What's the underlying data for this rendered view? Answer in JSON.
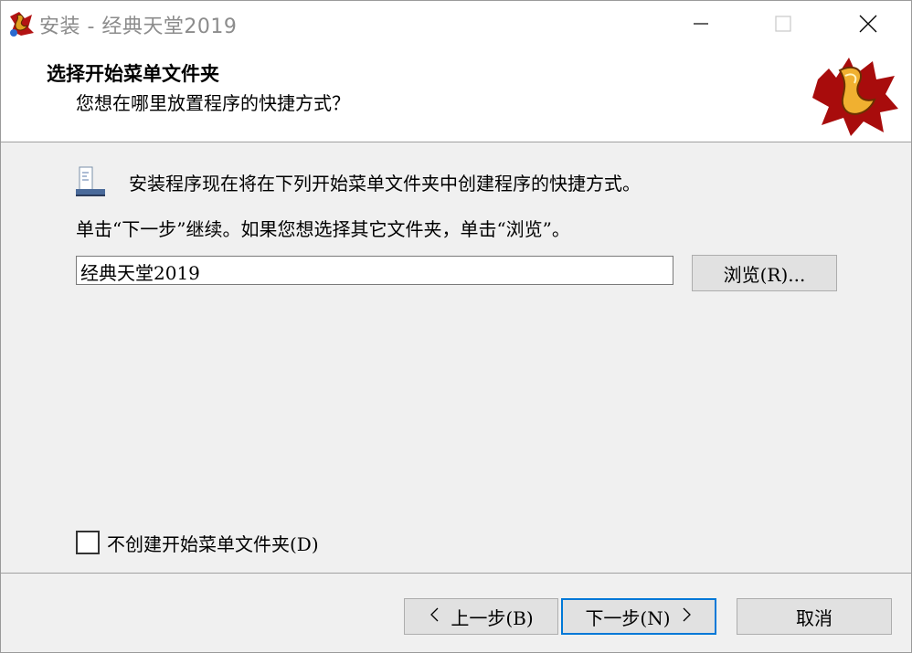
{
  "window": {
    "title": "安装 - 经典天堂2019",
    "icons": {
      "app": "game-logo-icon",
      "minimize": "minimize-icon",
      "maximize": "maximize-icon",
      "close": "close-icon"
    }
  },
  "header": {
    "title": "选择开始菜单文件夹",
    "subtitle": "您想在哪里放置程序的快捷方式？",
    "logo_icon": "game-logo-icon"
  },
  "main": {
    "folder_icon": "start-menu-folder-icon",
    "description_line1": "安装程序现在将在下列开始菜单文件夹中创建程序的快捷方式。",
    "description_line2": "单击“下一步”继续。如果您想选择其它文件夹，单击“浏览”。",
    "folder_value": "经典天堂2019",
    "browse_label": "浏览(R)...",
    "no_folder_checkbox": {
      "label": "不创建开始菜单文件夹(D)",
      "checked": false
    }
  },
  "footer": {
    "back_label": "上一步(B)",
    "next_label": "下一步(N)",
    "cancel_label": "取消"
  },
  "colors": {
    "accent": "#0078d7",
    "title_text": "#8c8c8c",
    "background": "#f0f0f0"
  }
}
